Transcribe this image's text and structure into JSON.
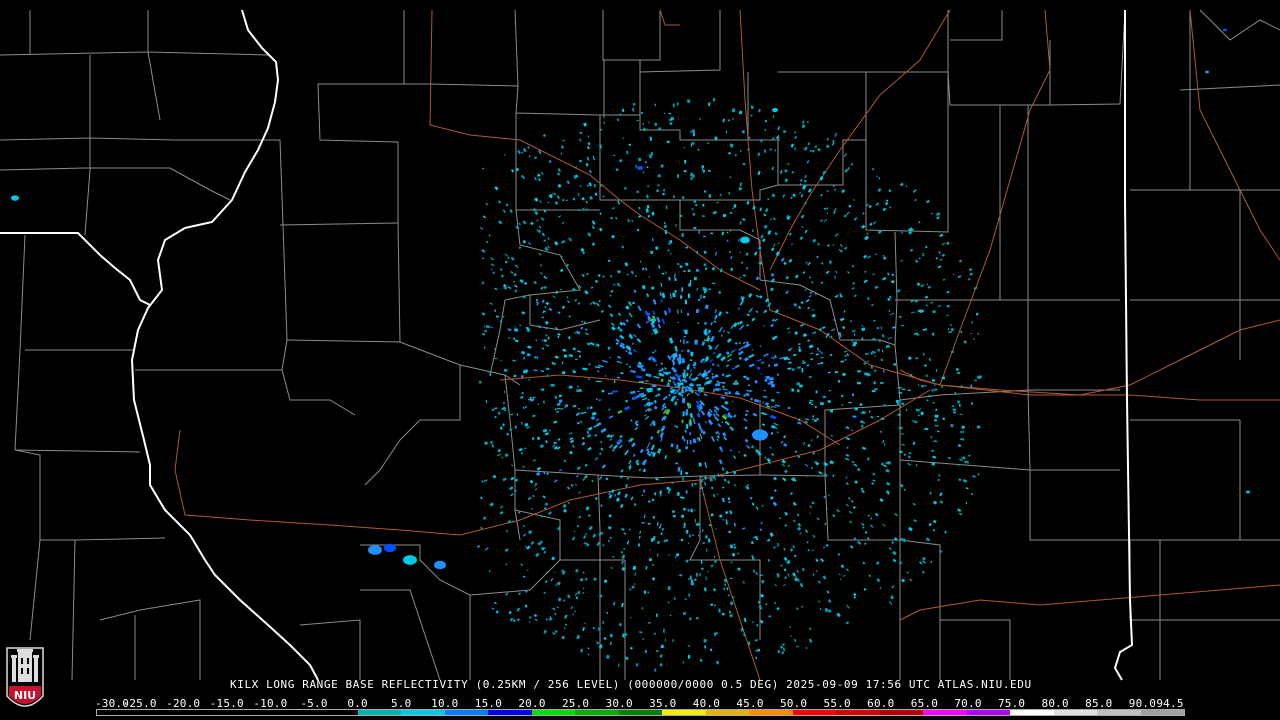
{
  "footer": {
    "title": "KILX LONG RANGE BASE REFLECTIVITY (0.25KM / 256 LEVEL) (000000/0000 0.5 DEG) 2025-09-09 17:56 UTC  ATLAS.NIU.EDU"
  },
  "logo": {
    "text": "NIU",
    "colors": {
      "shield": "#c8102e",
      "text": "#ffffff"
    }
  },
  "color_scale": {
    "labels": [
      "-30.0",
      "-25.0",
      "-20.0",
      "-15.0",
      "-10.0",
      "-5.0",
      "0.0",
      "5.0",
      "10.0",
      "15.0",
      "20.0",
      "25.0",
      "30.0",
      "35.0",
      "40.0",
      "45.0",
      "50.0",
      "55.0",
      "60.0",
      "65.0",
      "70.0",
      "75.0",
      "80.0",
      "85.0",
      "90.0",
      "94.5"
    ],
    "colors": [
      "#000000",
      "#000000",
      "#000000",
      "#000000",
      "#000000",
      "#000000",
      "#00b4b4",
      "#00c8e6",
      "#0080ff",
      "#0000f0",
      "#00e000",
      "#00b000",
      "#008000",
      "#f0f000",
      "#e6b400",
      "#ff8c00",
      "#ff0000",
      "#d20000",
      "#b40000",
      "#ff00ff",
      "#b400ff",
      "#ffffff",
      "#e0e0e0",
      "#c0c0c0",
      "#a0a0a0"
    ]
  },
  "map_style": {
    "county_lines": "#8c8c8c",
    "state_lines": "#ffffff",
    "river_lines": "#ffffff",
    "highway_lines": "#b05a30",
    "echo_colors": [
      "#00a0b4",
      "#00c8e6",
      "#1e90ff",
      "#0050ff",
      "#40c040"
    ]
  }
}
